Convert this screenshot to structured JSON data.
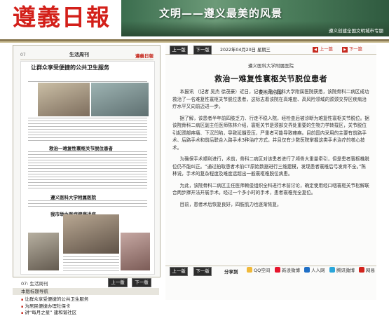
{
  "header": {
    "masthead": "遵義日報",
    "banner_slogan": "文明——遵义最美的风景",
    "banner_sub": "遵义创建全国文明城市专题"
  },
  "left": {
    "page_tag": "07",
    "page_title": "生活周刊",
    "page_logo": "遵義日報",
    "a1_title": "让群众享受便捷的公共卫生服务",
    "h2": "救治一难复性寰枢关节脱位患者",
    "h3": "遵义医科大学附属医院",
    "h4": "我市举办医疗健康讲座",
    "pagenav_label": "07: 生活周刊",
    "prev": "上一版",
    "next": "下一版",
    "list_title": "本版标题导航",
    "items": [
      "让群众享受便捷的公共卫生服务",
      "为居民便捷办理社保卡",
      "讲“每月之星” 建和谐社区"
    ]
  },
  "right": {
    "toolbar": {
      "prev": "上一版",
      "next": "下一版",
      "date": "2022年04月20日 星期三",
      "prev_article": "上一篇",
      "next_article": "下一篇"
    },
    "kicker": "遵义医科大学附属医院",
    "title": "救治一难复性寰枢关节脱位患者",
    "byline": "吴杰 徐茂豪",
    "paragraphs": [
      "本报讯 （记者 吴杰 徐茂豪）近日，记者从遵义医科大学附属医院获悉，该院骨科二病区成功救治了一名难复性寰枢关节脱位患者，这标志着该院在高难度、高风险领域的颈颈交界区疾病治疗水平又向前迈进一步。",
      "据了解，该患者半年前四肢乏力、行走不稳入院，经检查后被诊断为难复性寰枢关节脱位。据该院骨科二病区副主任医师陈林介绍，寰枢关节是颈部交界处重要的生物力学转载区，关节脱位引起颈部疼痛、下沉凹陷，导致延髓受压，严重者可能导致瘫痪。目前国内采用的主要有前路手术、后路手术和前后联合入路手术3种治疗方式，并且仅有少数医院掌握这类手术治疗的核心技术。",
      "为确保手术顺利进行，术前，骨科二病区对该患者进行了颅骨大重量牵引，但是患者寰枢椎脱位仍不能纠正。“通过拍取患者术前CT原始数据进行三维建模，发现患者寰椎后弓发育不全。”陈林说，手术的复杂程度及难度远超出一般寰枢椎脱位病患。",
      "为此，该院骨科二病区主任医师赖俊组织全科进行术前讨论，确定使用经口咽寰枢关节松解联合两步撑开法开展手术。经过一个多小时的手术，患者寰椎完全复位。",
      "目前，患者术后恢复良好，四肢肌力也逐渐恢复。"
    ],
    "bottom": {
      "prev": "上一版",
      "next": "下一版",
      "share": "分享到",
      "targets": [
        "QQ空间",
        "新浪微博",
        "人人网",
        "腾讯微博",
        "网易"
      ]
    }
  },
  "colors": {
    "accent": "#c62b20",
    "button": "#2c2c2c"
  }
}
